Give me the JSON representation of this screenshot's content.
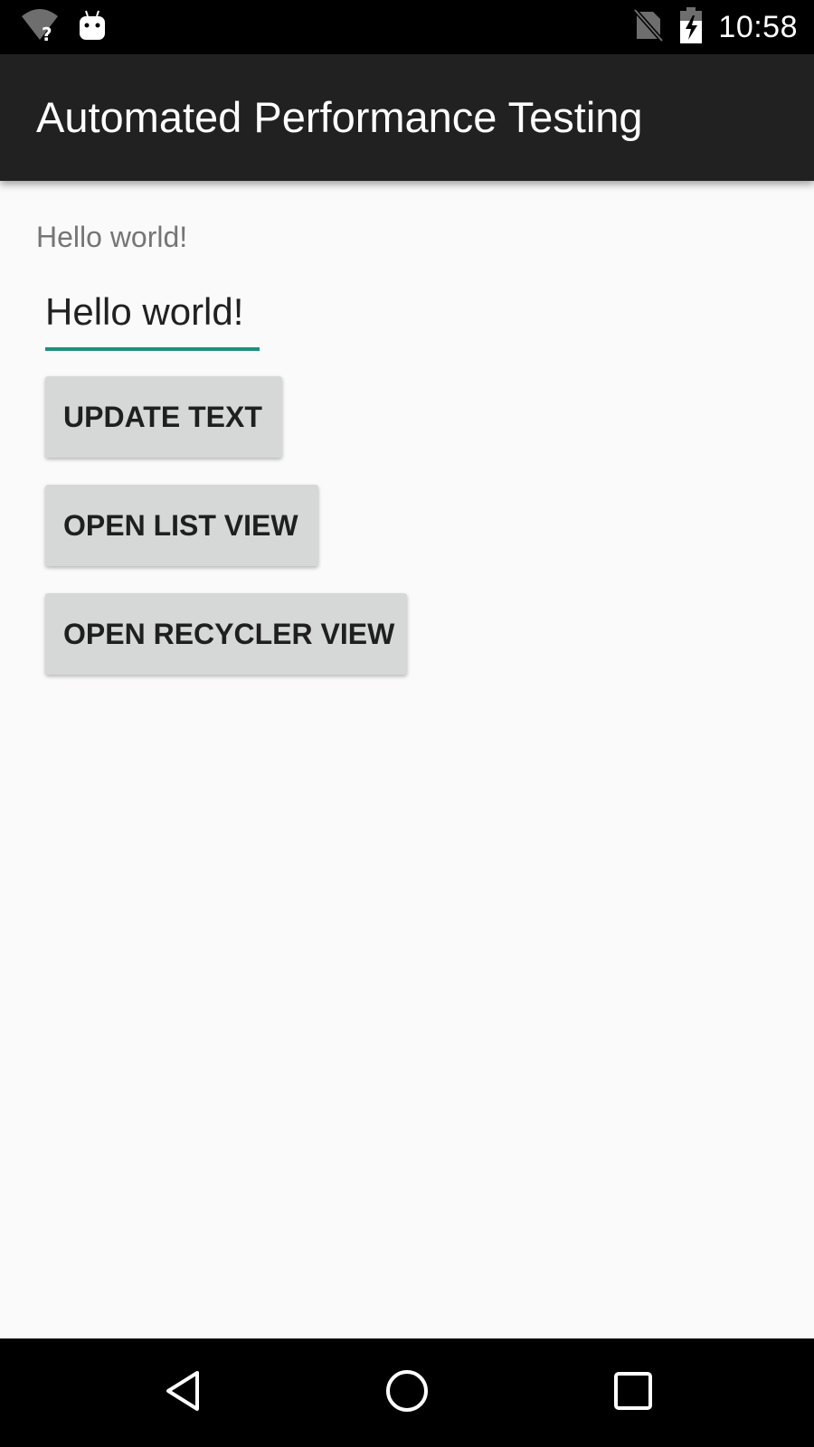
{
  "status_bar": {
    "time": "10:58",
    "icons": [
      "wifi-unknown-icon",
      "android-debug-icon",
      "no-sim-icon",
      "battery-charging-icon"
    ]
  },
  "app_bar": {
    "title": "Automated Performance Testing"
  },
  "main": {
    "label_text": "Hello world!",
    "edit_text_value": "Hello world!",
    "buttons": {
      "update_text": "UPDATE TEXT",
      "open_list_view": "OPEN LIST VIEW",
      "open_recycler_view": "OPEN RECYCLER VIEW"
    }
  },
  "nav_bar": {
    "icons": [
      "back-icon",
      "home-icon",
      "recents-icon"
    ]
  },
  "colors": {
    "status_bar": "#000000",
    "app_bar": "#212121",
    "background": "#fafafa",
    "accent_underline": "#1e9080",
    "button": "#d6d7d7",
    "nav_bar": "#000000"
  }
}
